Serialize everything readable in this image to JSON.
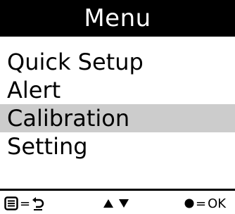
{
  "title": "Menu",
  "menu": {
    "items": [
      {
        "label": "Quick Setup",
        "selected": false
      },
      {
        "label": "Alert",
        "selected": false
      },
      {
        "label": "Calibration",
        "selected": true
      },
      {
        "label": "Setting",
        "selected": false
      }
    ]
  },
  "footer": {
    "menu_key": {
      "icon": "menu-key-icon",
      "equals": "=",
      "action_icon": "back-arrow-icon"
    },
    "arrows": {
      "up_icon": "triangle-up-icon",
      "down_icon": "triangle-down-icon"
    },
    "ok_key": {
      "icon": "filled-circle-icon",
      "equals": "=",
      "label": "OK"
    }
  },
  "colors": {
    "title_background": "#000000",
    "title_text": "#ffffff",
    "selected_background": "#cccccc",
    "text": "#000000"
  }
}
